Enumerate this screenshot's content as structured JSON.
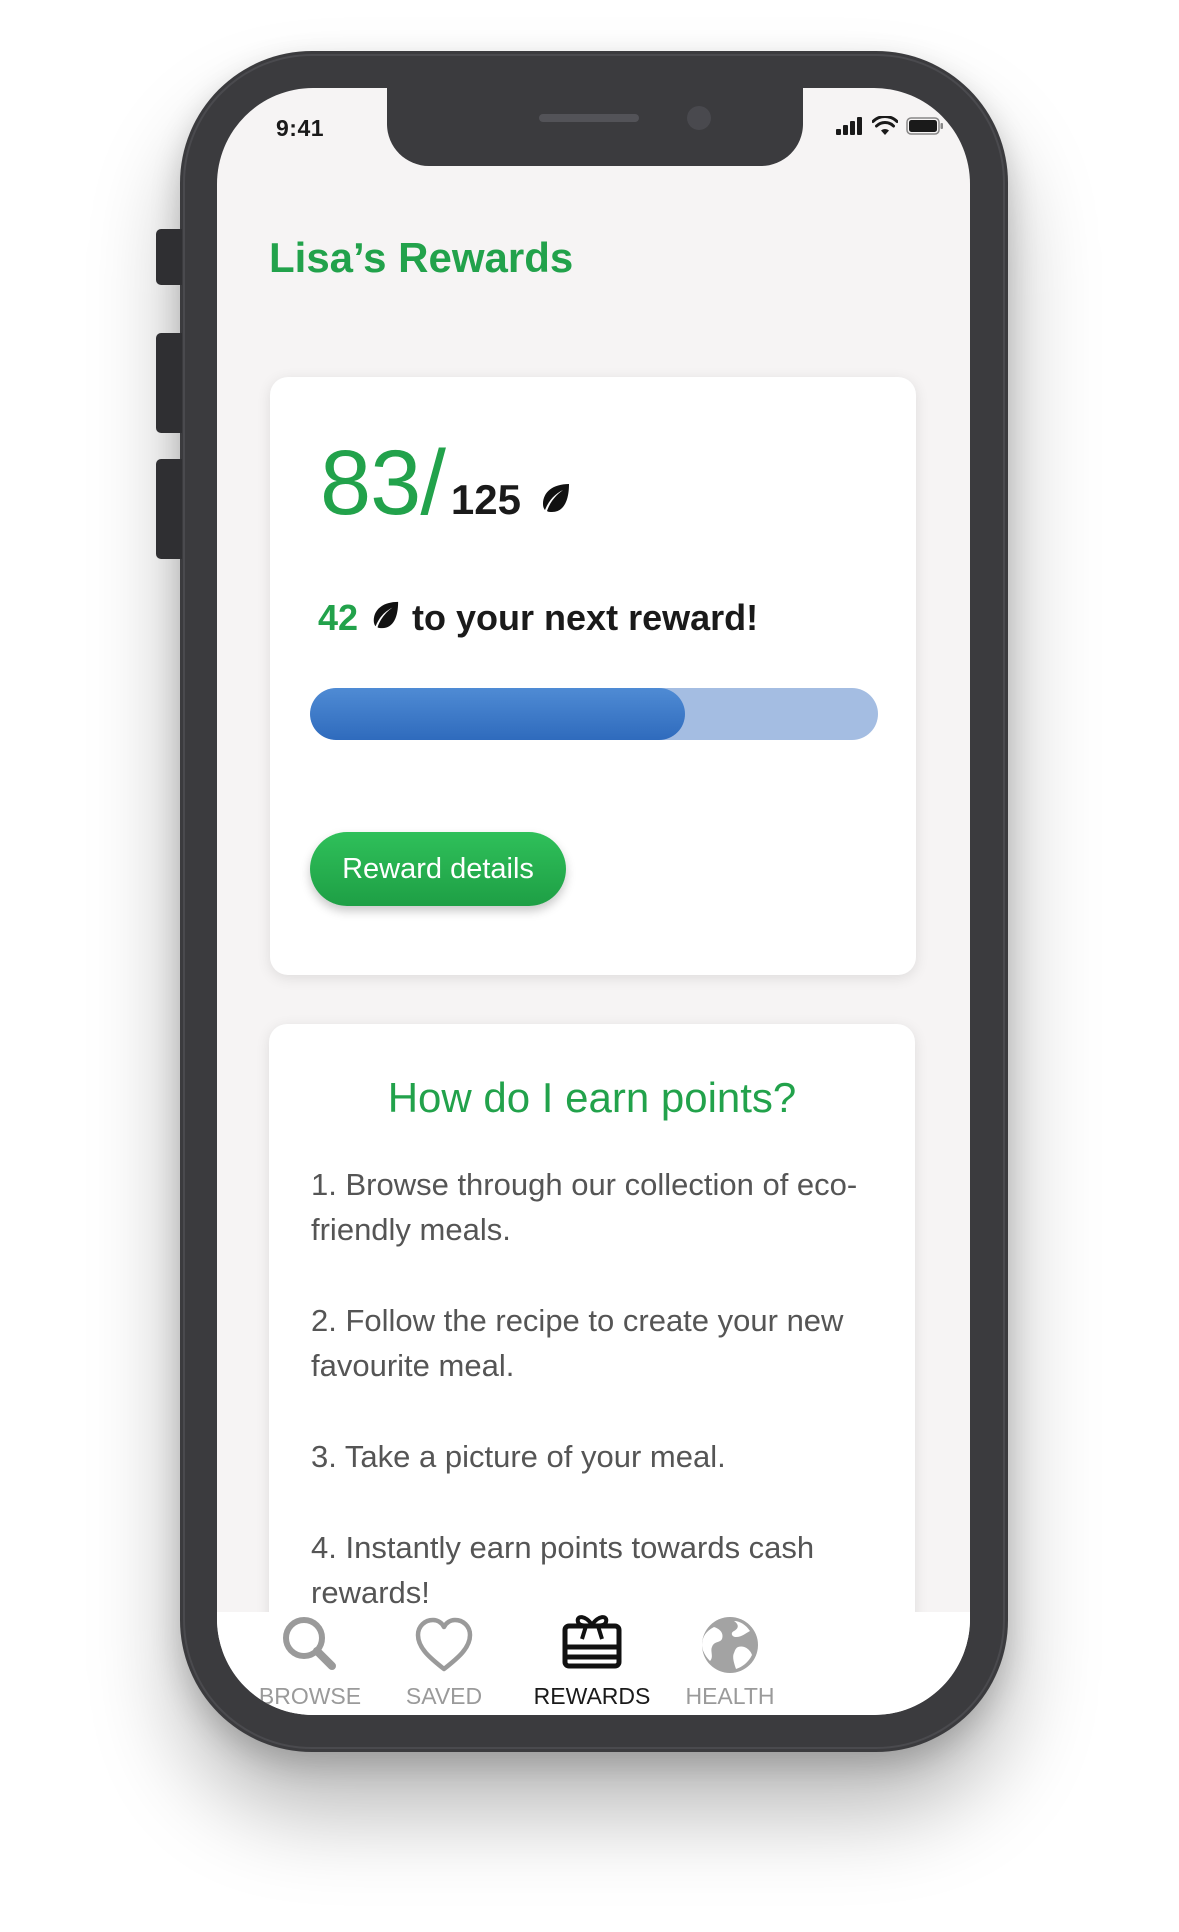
{
  "status_bar": {
    "time": "9:41",
    "icons": [
      "cellular-signal-icon",
      "wifi-icon",
      "battery-icon"
    ]
  },
  "page": {
    "title": "Lisa’s Rewards"
  },
  "points_card": {
    "current_points": "83/",
    "total_points": "125",
    "points_icon": "leaf-icon",
    "next_reward_count": "42",
    "next_reward_text": "to your next reward!",
    "progress_fraction": 0.66,
    "details_button_label": "Reward details"
  },
  "earn_card": {
    "title": "How do I earn points?",
    "steps": [
      "1. Browse through our collection of eco-friendly meals.",
      "2. Follow the recipe to create your new favourite meal.",
      "3. Take a picture of your meal.",
      "4. Instantly earn points towards cash rewards!"
    ]
  },
  "tab_bar": {
    "tabs": [
      {
        "label": "BROWSE",
        "icon": "search-icon",
        "active": false
      },
      {
        "label": "SAVED",
        "icon": "heart-icon",
        "active": false
      },
      {
        "label": "REWARDS",
        "icon": "gift-card-icon",
        "active": true
      },
      {
        "label": "HEALTH",
        "icon": "globe-icon",
        "active": false
      }
    ]
  },
  "colors": {
    "brand_green": "#22a24b",
    "progress_fill": "#2f6bbd",
    "progress_track": "#a4bde2",
    "active_tab": "#1a1a1a",
    "inactive_tab": "#9a9a9a"
  }
}
